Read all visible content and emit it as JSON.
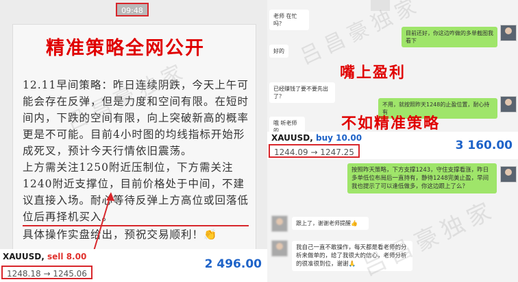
{
  "left": {
    "timestamp": "09:48",
    "note_title": "精准策略全网公开",
    "note_paragraphs": [
      "12.11早间策略：昨日连续阴跌，今天上午可能会存在反弹，但是力度和空间有限。在短时间内，下跌的空间有限，向上突破新高的概率更是不可能。目前4小时图的均线指标开始形成死叉，预计今天行情依旧震荡。",
      "上方需关注1250附近压制位，下方需关注1240附近支撑位，目前价格处于中间，不建议直接入场。耐心等待反弹上方高位或回落低位后再择机买入。",
      "具体操作实盘给出，预祝交易顺利！👏"
    ],
    "trade": {
      "symbol": "XAUUSD,",
      "side": "sell 8.00",
      "prices": "1248.18 → 1245.06",
      "profit": "2 496.00"
    }
  },
  "right": {
    "messages": [
      {
        "dir": "in",
        "text": "老师 在忙吗？"
      },
      {
        "dir": "out",
        "text": "目前还好，你这边咋做的多单截图我看下"
      },
      {
        "dir": "in",
        "text": "好的"
      },
      {
        "dir": "in",
        "text": "已经赚钱了要不要先出了？"
      },
      {
        "dir": "out",
        "text": "不用，就按照昨天1248的止盈位置，耐心持有"
      },
      {
        "dir": "in",
        "text": "哦 听老师的"
      },
      {
        "dir": "out",
        "text": "按照昨天策略，下方支撑1243，守住支撑看涨，昨日多单低位布局后一直持有，静待1248完美止盈，早间我也提示了可以逢低做多，你这边跟上了么？"
      },
      {
        "dir": "in",
        "text": "跟上了，谢谢老师提醒👍"
      },
      {
        "dir": "in",
        "text": "我自己一直不敢操作，每天都是看老师的分析来做单的，给了我很大的信心，老师分析的很准很到位，谢谢🙏"
      }
    ],
    "caption1": "嘴上盈利",
    "caption2": "不如精准策略",
    "trade": {
      "symbol": "XAUUSD,",
      "side": "buy 10.00",
      "prices": "1244.09 → 1247.25",
      "profit": "3 160.00"
    }
  },
  "watermark": "吕昌豪独家"
}
